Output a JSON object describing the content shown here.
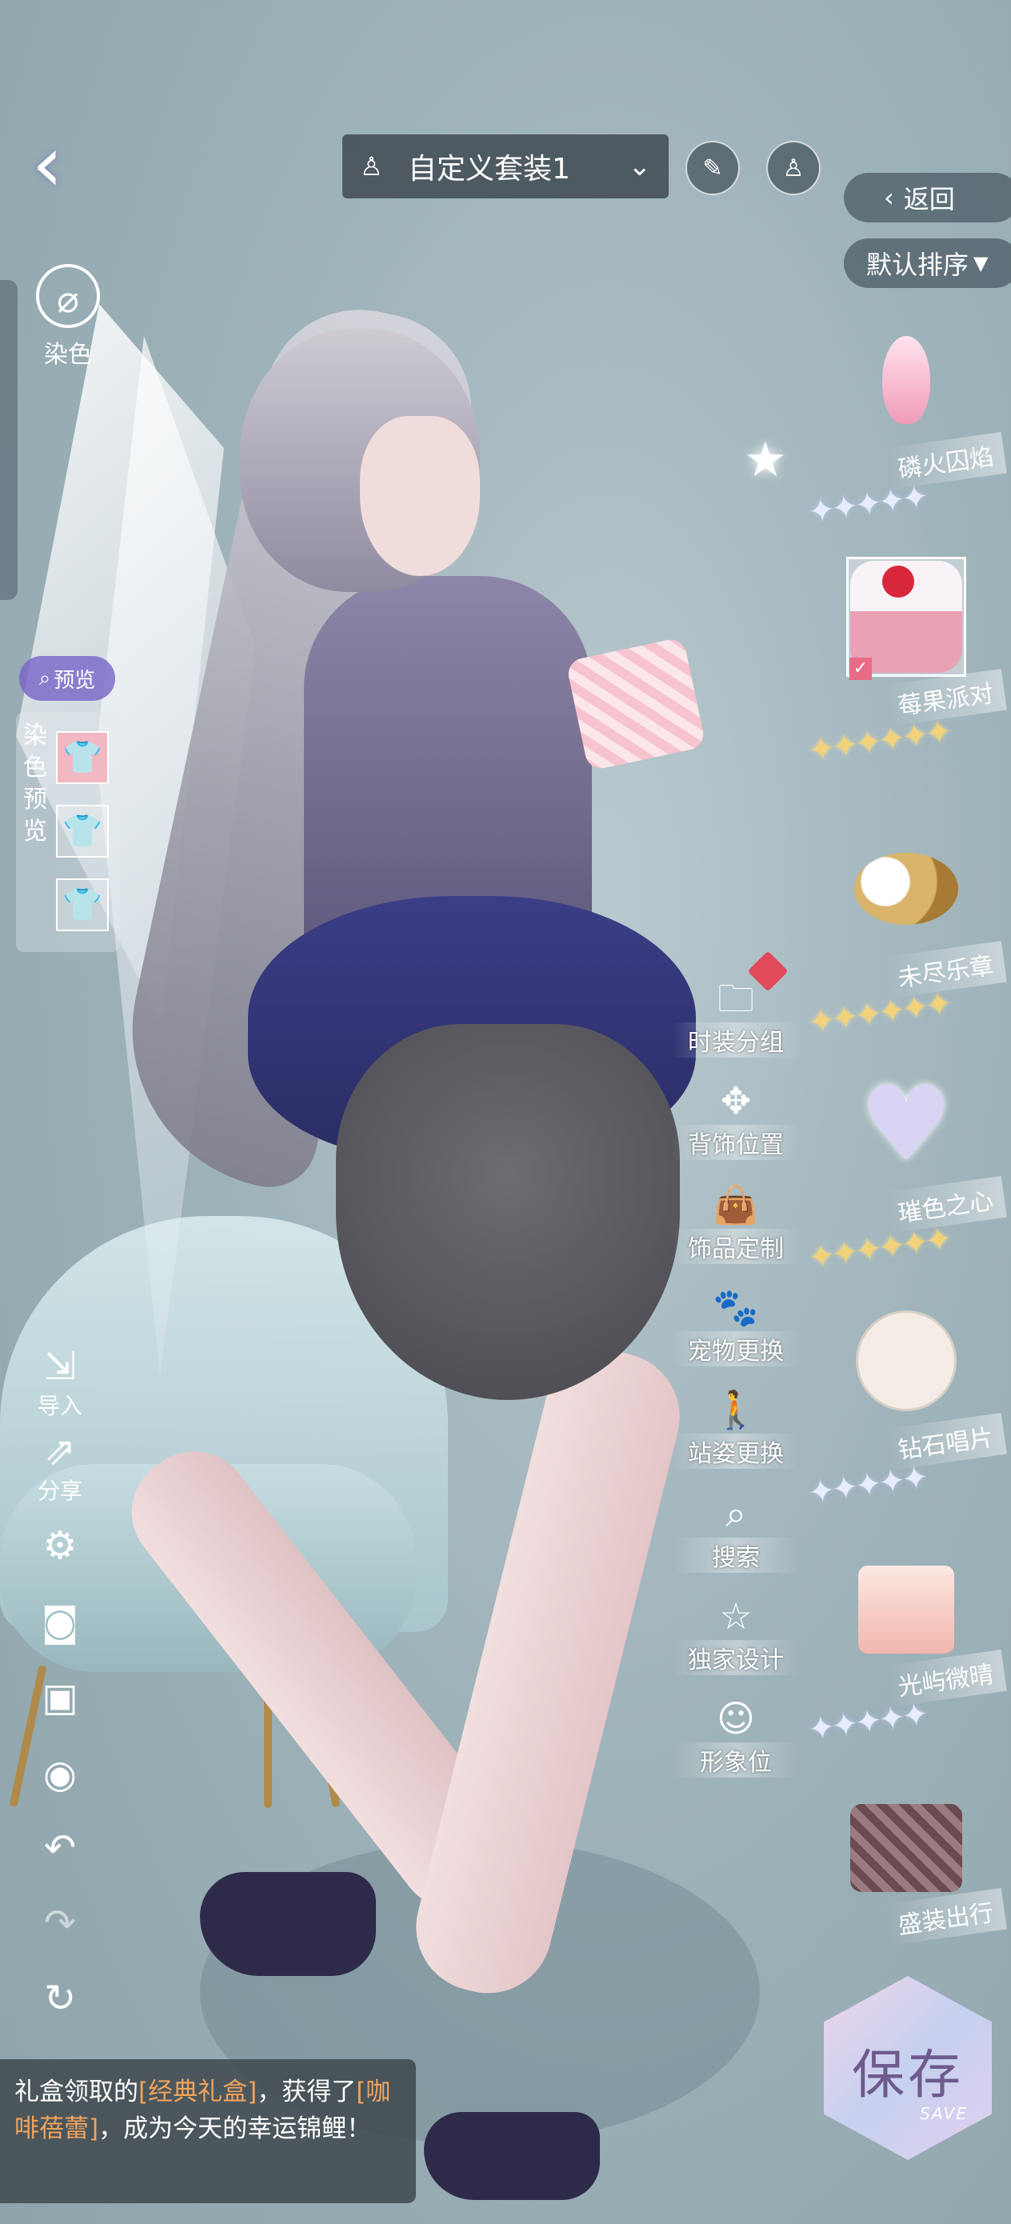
{
  "outfit_selector": {
    "name": "自定义套装1"
  },
  "dye": {
    "label": "染色"
  },
  "nav": {
    "return_label": "返回",
    "sort_label": "默认排序"
  },
  "dye_preview": {
    "pill_label": "预览",
    "panel_label": "染色预览"
  },
  "left_tools": {
    "import_label": "导入",
    "share_label": "分享"
  },
  "side_menu": [
    {
      "label": "时装分组"
    },
    {
      "label": "背饰位置"
    },
    {
      "label": "饰品定制"
    },
    {
      "label": "宠物更换"
    },
    {
      "label": "站姿更换"
    },
    {
      "label": "搜索"
    },
    {
      "label": "独家设计"
    },
    {
      "label": "形象位"
    }
  ],
  "items": [
    {
      "name": "磷火囚焰",
      "stars": 5,
      "star_color": "silver"
    },
    {
      "name": "莓果派对",
      "stars": 6,
      "star_color": "gold",
      "selected": true
    },
    {
      "name": "未尽乐章",
      "stars": 6,
      "star_color": "gold"
    },
    {
      "name": "璀色之心",
      "stars": 6,
      "star_color": "gold"
    },
    {
      "name": "钻石唱片",
      "stars": 5,
      "star_color": "silver"
    },
    {
      "name": "光屿微晴",
      "stars": 5,
      "star_color": "silver"
    },
    {
      "name": "盛装出行",
      "stars": 0,
      "star_color": "silver"
    }
  ],
  "save_button": {
    "label": "保存",
    "sub": "SAVE"
  },
  "notification": {
    "prefix": "礼盒领取的",
    "gift": "[经典礼盒]",
    "middle": "，获得了",
    "reward": "[咖啡蓓蕾]",
    "suffix": "，成为今天的幸运锦鲤！"
  },
  "colors": {
    "highlight": "#f0a35c",
    "panel_bg": "#3c444a",
    "gold_star": "#f1d27a"
  }
}
